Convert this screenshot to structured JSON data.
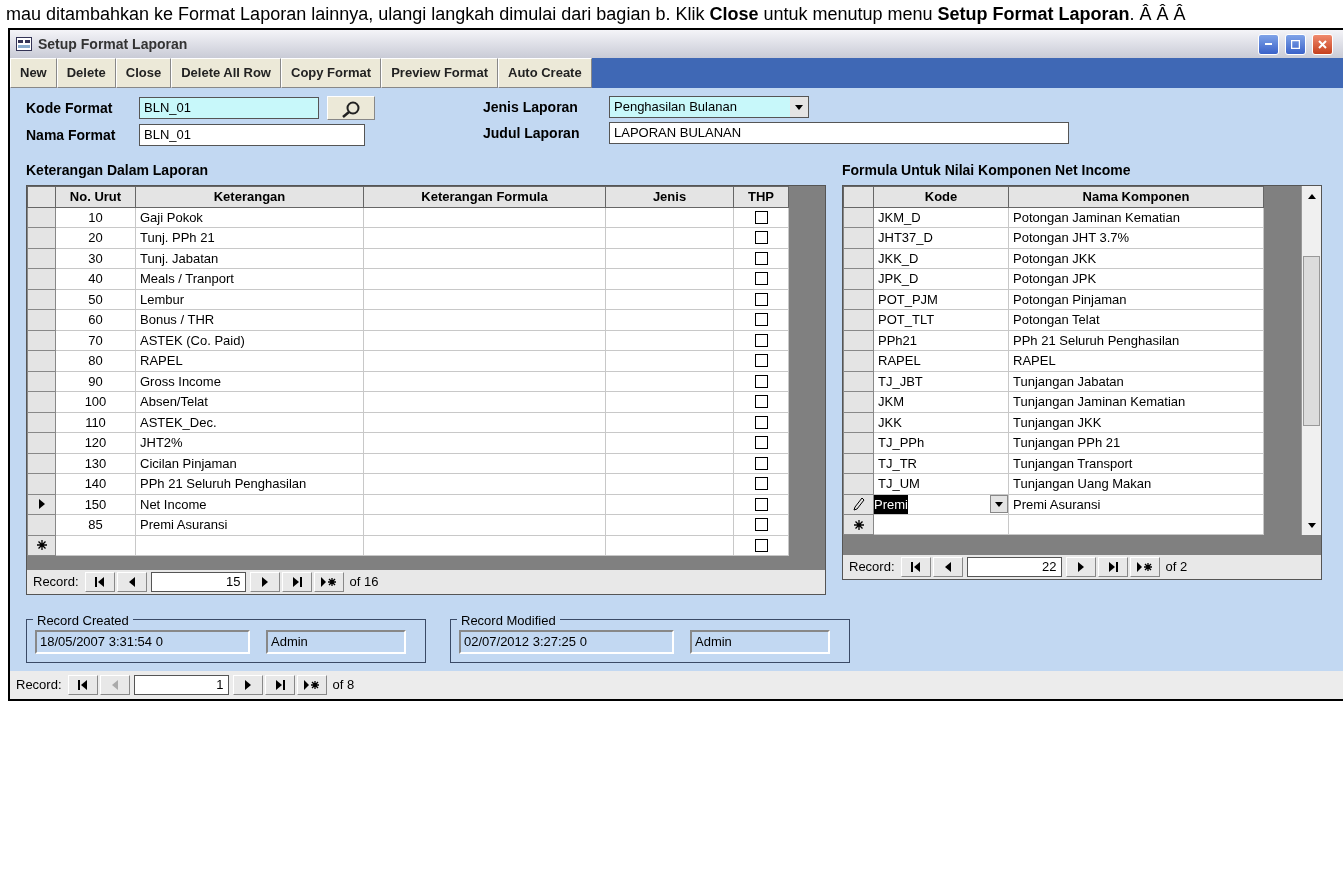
{
  "overlay_text": "mau ditambahkan ke Format Laporan lainnya, ulangi langkah dimulai dari bagian b. Klik **Close** untuk menutup menu **Setup Format Laporan**.  Â  Â  Â",
  "window": {
    "title": "Setup Format Laporan"
  },
  "toolbar": [
    "New",
    "Delete",
    "Close",
    "Delete All Row",
    "Copy Format",
    "Preview Format",
    "Auto Create"
  ],
  "fields": {
    "kode_format": {
      "label": "Kode Format",
      "value": "BLN_01"
    },
    "nama_format": {
      "label": "Nama Format",
      "value": "BLN_01"
    },
    "jenis_laporan": {
      "label": "Jenis Laporan",
      "value": "Penghasilan Bulanan"
    },
    "judul_laporan": {
      "label": "Judul Laporan",
      "value": "LAPORAN BULANAN"
    }
  },
  "left_grid": {
    "title": "Keterangan Dalam Laporan",
    "columns": [
      "No. Urut",
      "Keterangan",
      "Keterangan Formula",
      "Jenis",
      "THP"
    ],
    "rows": [
      {
        "no": "10",
        "keterangan": "Gaji Pokok",
        "thp": false,
        "selected": false
      },
      {
        "no": "20",
        "keterangan": "Tunj. PPh 21",
        "thp": false,
        "selected": false
      },
      {
        "no": "30",
        "keterangan": "Tunj. Jabatan",
        "thp": false,
        "selected": false
      },
      {
        "no": "40",
        "keterangan": "Meals / Tranport",
        "thp": false,
        "selected": false
      },
      {
        "no": "50",
        "keterangan": "Lembur",
        "thp": false,
        "selected": false
      },
      {
        "no": "60",
        "keterangan": "Bonus / THR",
        "thp": false,
        "selected": false
      },
      {
        "no": "70",
        "keterangan": "ASTEK (Co. Paid)",
        "thp": false,
        "selected": false
      },
      {
        "no": "80",
        "keterangan": "RAPEL",
        "thp": false,
        "selected": false
      },
      {
        "no": "90",
        "keterangan": "Gross Income",
        "thp": false,
        "selected": false
      },
      {
        "no": "100",
        "keterangan": "Absen/Telat",
        "thp": false,
        "selected": false
      },
      {
        "no": "110",
        "keterangan": "ASTEK_Dec.",
        "thp": false,
        "selected": false
      },
      {
        "no": "120",
        "keterangan": "JHT2%",
        "thp": false,
        "selected": false
      },
      {
        "no": "130",
        "keterangan": "Cicilan Pinjaman",
        "thp": false,
        "selected": false
      },
      {
        "no": "140",
        "keterangan": "PPh 21 Seluruh Penghasilan",
        "thp": false,
        "selected": false
      },
      {
        "no": "150",
        "keterangan": "Net Income",
        "thp": false,
        "selected": true
      },
      {
        "no": "85",
        "keterangan": "Premi Asuransi",
        "thp": false,
        "selected": false
      }
    ],
    "new_row": {
      "thp": false
    },
    "nav": {
      "label": "Record:",
      "value": "15",
      "total": "of 16",
      "buttons": [
        {
          "kind": "first",
          "disabled": false
        },
        {
          "kind": "prev",
          "disabled": false
        },
        {
          "kind": "field"
        },
        {
          "kind": "next",
          "disabled": false
        },
        {
          "kind": "last",
          "disabled": false
        },
        {
          "kind": "new",
          "disabled": false
        }
      ]
    }
  },
  "right_grid": {
    "title": "Formula Untuk Nilai Komponen Net Income",
    "columns": [
      "Kode",
      "Nama Komponen"
    ],
    "rows": [
      {
        "kode": "JKM_D",
        "nama": "Potongan Jaminan Kematian",
        "editing": false
      },
      {
        "kode": "JHT37_D",
        "nama": "Potongan JHT 3.7%",
        "editing": false
      },
      {
        "kode": "JKK_D",
        "nama": "Potongan JKK",
        "editing": false
      },
      {
        "kode": "JPK_D",
        "nama": "Potongan JPK",
        "editing": false
      },
      {
        "kode": "POT_PJM",
        "nama": "Potongan Pinjaman",
        "editing": false
      },
      {
        "kode": "POT_TLT",
        "nama": "Potongan Telat",
        "editing": false
      },
      {
        "kode": "PPh21",
        "nama": "PPh 21 Seluruh Penghasilan",
        "editing": false
      },
      {
        "kode": "RAPEL",
        "nama": "RAPEL",
        "editing": false
      },
      {
        "kode": "TJ_JBT",
        "nama": "Tunjangan Jabatan",
        "editing": false
      },
      {
        "kode": "JKM",
        "nama": "Tunjangan Jaminan Kematian",
        "editing": false
      },
      {
        "kode": "JKK",
        "nama": "Tunjangan JKK",
        "editing": false
      },
      {
        "kode": "TJ_PPh",
        "nama": "Tunjangan PPh 21",
        "editing": false
      },
      {
        "kode": "TJ_TR",
        "nama": "Tunjangan Transport",
        "editing": false
      },
      {
        "kode": "TJ_UM",
        "nama": "Tunjangan Uang Makan",
        "editing": false
      },
      {
        "kode": "Premi",
        "nama": "Premi Asuransi",
        "editing": true
      }
    ],
    "nav": {
      "label": "Record:",
      "value": "22",
      "total": "of 2",
      "buttons": [
        {
          "kind": "first",
          "disabled": false
        },
        {
          "kind": "prev",
          "disabled": false
        },
        {
          "kind": "field"
        },
        {
          "kind": "next",
          "disabled": false
        },
        {
          "kind": "last",
          "disabled": false
        },
        {
          "kind": "new",
          "disabled": false
        }
      ]
    }
  },
  "record_created": {
    "legend": "Record Created",
    "date": "18/05/2007 3:31:54 0",
    "user": "Admin"
  },
  "record_modified": {
    "legend": "Record Modified",
    "date": "02/07/2012 3:27:25 0",
    "user": "Admin"
  },
  "form_nav": {
    "label": "Record:",
    "value": "1",
    "total": "of 8",
    "buttons": [
      {
        "kind": "first",
        "disabled": false
      },
      {
        "kind": "prev",
        "disabled": true
      },
      {
        "kind": "field"
      },
      {
        "kind": "next",
        "disabled": false
      },
      {
        "kind": "last",
        "disabled": false
      },
      {
        "kind": "new",
        "disabled": false
      }
    ]
  }
}
